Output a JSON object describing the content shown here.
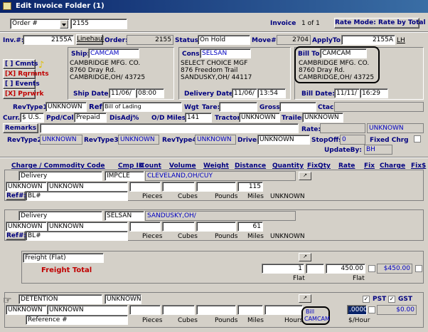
{
  "window": {
    "title": "Edit Invoice Folder (1)"
  },
  "header": {
    "search_type": "Order #",
    "search_value": "2155",
    "invoice_label": "Invoice",
    "invoice_pos": "1 of 1",
    "rate_mode": "Rate Mode: Rate by Total"
  },
  "top": {
    "inv_label": "Inv.#:",
    "inv_value": "2155A",
    "linehaul_label": "Linehaul",
    "order_label": "Order:",
    "order_value": "2155",
    "status_label": "Status:",
    "status_value": "On Hold",
    "move_label": "Move#:",
    "move_value": "2704",
    "applyto_label": "ApplyTo:",
    "applyto_value": "2155A",
    "lh_label": "LH"
  },
  "side_buttons": {
    "cmnts": "[  ] Cmnts",
    "rqrmnts": "[X] Rqrmnts",
    "events": "[  ] Events",
    "pprwrk": "[X] Pprwrk"
  },
  "ship": {
    "label": "Ship:",
    "code": "CAMCAM",
    "name": "CAMBRIDGE MFG. CO.",
    "addr1": "8760 Dray Rd.",
    "addr2": "CAMBRIDGE,OH/ 43725",
    "date_label": "Ship Date:",
    "date": "11/06/",
    "time": "08:00"
  },
  "cons": {
    "label": "Cons:",
    "code": "SELSAN",
    "name": "SELECT CHOICE MGF",
    "addr1": "876 Freedom Trail",
    "addr2": "SANDUSKY,OH/ 44117",
    "date_label": "Delivery Date:",
    "date": "11/06/",
    "time": "13:54"
  },
  "billto": {
    "label": "Bill To:",
    "code": "CAMCAM",
    "name": "CAMBRIDGE MFG. CO.",
    "addr1": "8760 Dray Rd.",
    "addr2": "CAMBRIDGE,OH/ 43725",
    "date_label": "Bill Date:",
    "date": "11/11/",
    "time": "16:29"
  },
  "details": {
    "revtype1_label": "RevType1",
    "revtype1": "UNKNOWN",
    "ref_label": "Ref",
    "ref_value": "Bill of Lading",
    "wgt_label": "Wgt",
    "tare_label": "Tare:",
    "gross_label": "Gross:",
    "ctac_label": "Ctac",
    "curr_label": "Curr.",
    "curr": "$ U.S.",
    "ppdcol_label": "Ppd/Col",
    "ppdcol": "Prepaid",
    "disadj_label": "DisAdj%",
    "od_label": "O/D Miles",
    "od_value": "141",
    "tractor_label": "Tractor",
    "tractor": "UNKNOWN",
    "trailer_label": "Trailer",
    "trailer": "UNKNOWN",
    "remarks_label": "Remarks",
    "rate_label": "Rate:",
    "rate_value": "UNKNOWN",
    "revtype2_label": "RevType2",
    "revtype2": "UNKNOWN",
    "revtype3_label": "RevType3",
    "revtype3": "UNKNOWN",
    "revtype4_label": "RevType4",
    "revtype4": "UNKNOWN",
    "driver_label": "Driver",
    "driver": "UNKNOWN",
    "stopoffs_label": "StopOffs",
    "stopoffs": "0",
    "fixedchrg_label": "Fixed Chrg",
    "updateby_label": "UpdateBy:",
    "updateby": "BH"
  },
  "columns": [
    "Charge / Commodity Code",
    "Cmp ID",
    "Count",
    "Volume",
    "Weight",
    "Distance",
    "Quantity",
    "FixQty",
    "Rate",
    "Fix",
    "Charge",
    "Fix$"
  ],
  "stop1": {
    "charge": "Delivery",
    "cmp": "IMPCLE",
    "city": "CLEVELAND,OH/CUY",
    "u1": "UNKNOWN",
    "u2": "UNKNOWN",
    "distance": "115",
    "ref_label": "Ref#:",
    "ref_type": "BL#",
    "count_unit": "Pieces",
    "vol_unit": "Cubes",
    "wgt_unit": "Pounds",
    "dist_unit": "Miles",
    "qty": "UNKNOWN"
  },
  "stop2": {
    "charge": "Delivery",
    "cmp": "SELSAN",
    "city": "SANDUSKY,OH/",
    "u1": "UNKNOWN",
    "u2": "UNKNOWN",
    "distance": "61",
    "ref_label": "Ref#:",
    "ref_type": "BL#",
    "count_unit": "Pieces",
    "vol_unit": "Cubes",
    "wgt_unit": "Pounds",
    "dist_unit": "Miles",
    "qty": "UNKNOWN"
  },
  "freight": {
    "charge": "Freight (Flat)",
    "total_label": "Freight Total",
    "qty": "1",
    "rate": "450.00",
    "charge_total": "$450.00",
    "unit1": "Flat",
    "unit2": "Flat"
  },
  "detention": {
    "charge": "DETENTION",
    "cmp": "UNKNOWN",
    "u1": "UNKNOWN",
    "u2": "UNKNOWN",
    "ref_label": "Reference #",
    "count_unit": "Pieces",
    "vol_unit": "Cubes",
    "wgt_unit": "Pounds",
    "dist_unit": "Miles",
    "qty_unit": "Hours",
    "bill_label": "Bill",
    "bill_code": "CAMCAM",
    "rate": ".0000",
    "rate_unit": "$/Hour",
    "charge_total": "$0.00",
    "pst_label": "PST",
    "gst_label": "GST"
  }
}
